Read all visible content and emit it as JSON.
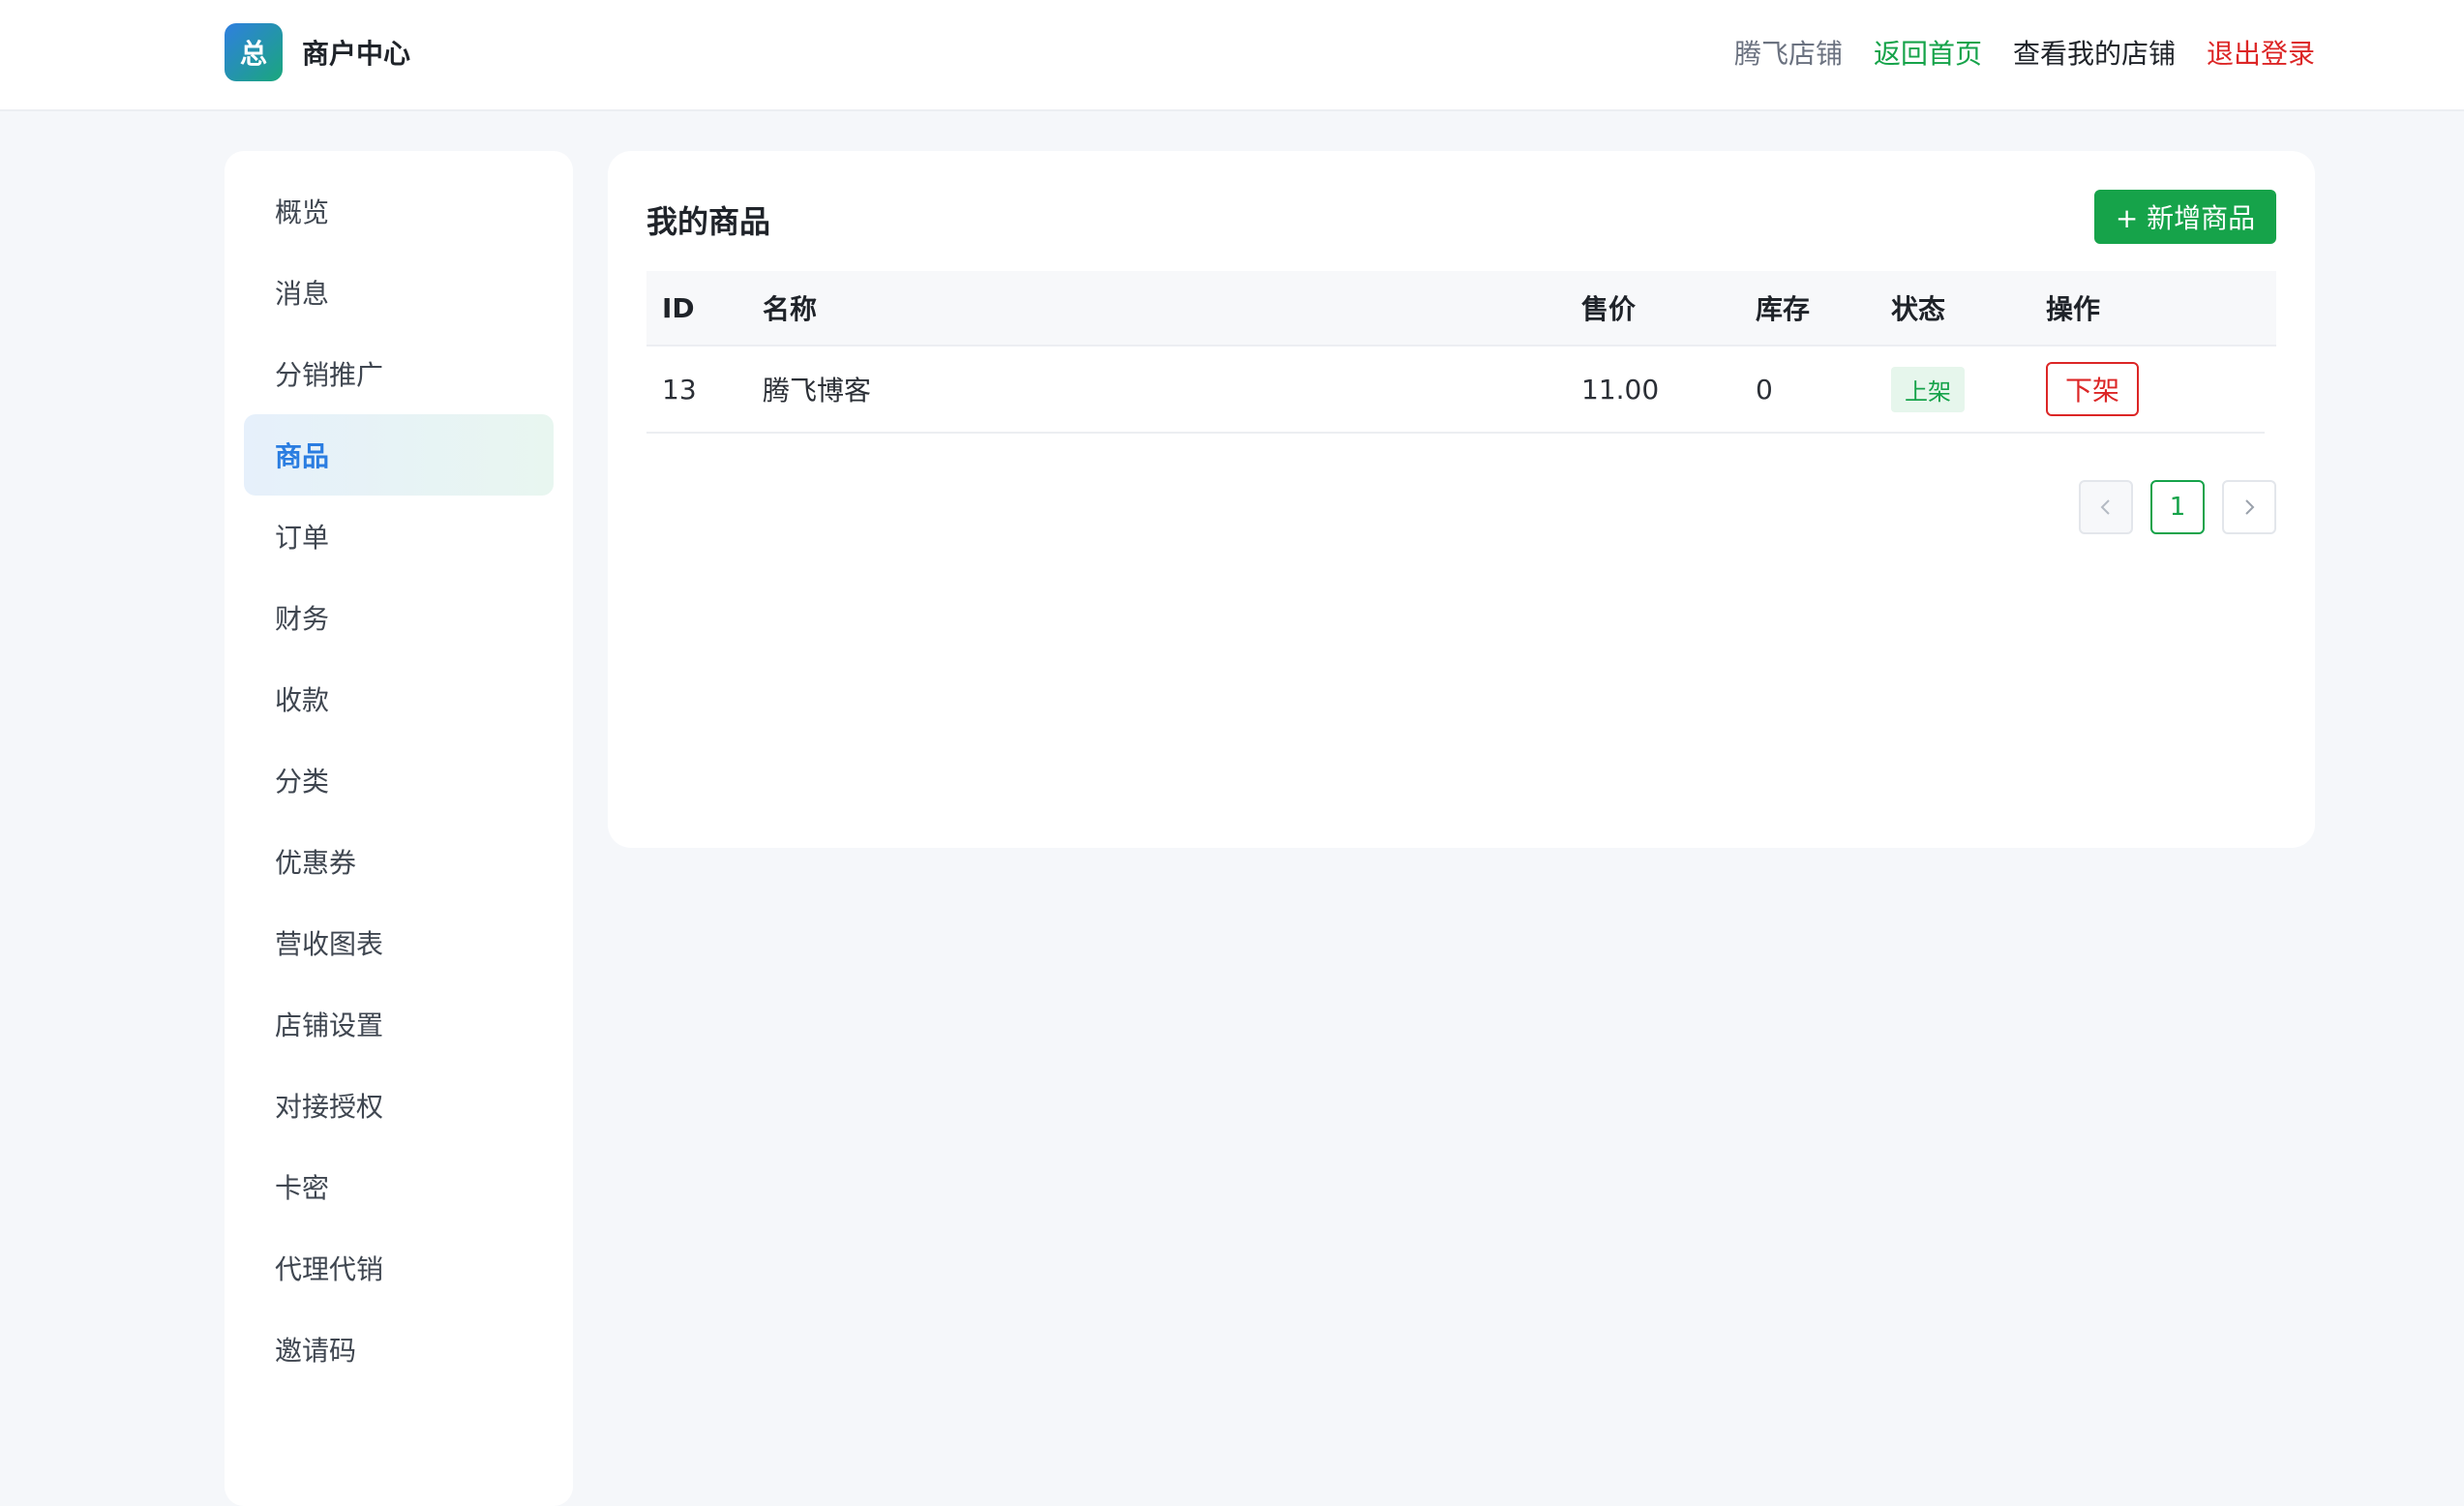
{
  "header": {
    "logo_glyph": "总",
    "title": "商户中心",
    "shop_name": "腾飞店铺",
    "home_link": "返回首页",
    "store_link": "查看我的店铺",
    "logout_link": "退出登录"
  },
  "sidebar": {
    "items": [
      {
        "label": "概览"
      },
      {
        "label": "消息"
      },
      {
        "label": "分销推广"
      },
      {
        "label": "商品"
      },
      {
        "label": "订单"
      },
      {
        "label": "财务"
      },
      {
        "label": "收款"
      },
      {
        "label": "分类"
      },
      {
        "label": "优惠券"
      },
      {
        "label": "营收图表"
      },
      {
        "label": "店铺设置"
      },
      {
        "label": "对接授权"
      },
      {
        "label": "卡密"
      },
      {
        "label": "代理代销"
      },
      {
        "label": "邀请码"
      }
    ],
    "active": "商品"
  },
  "main": {
    "title": "我的商品",
    "add_button": "+ 新增商品",
    "table": {
      "headers": [
        "ID",
        "名称",
        "售价",
        "库存",
        "状态",
        "操作"
      ],
      "rows": [
        {
          "id": "13",
          "name": "腾飞博客",
          "price": "11.00",
          "stock": "0",
          "status": "上架",
          "action": "下架"
        }
      ]
    },
    "pagination": {
      "prev_icon": "chevron-left-icon",
      "current": "1",
      "next_icon": "chevron-right-icon"
    }
  },
  "colors": {
    "accent_green": "#16a34a",
    "danger_red": "#dc2626",
    "active_blue": "#2a7de1"
  }
}
